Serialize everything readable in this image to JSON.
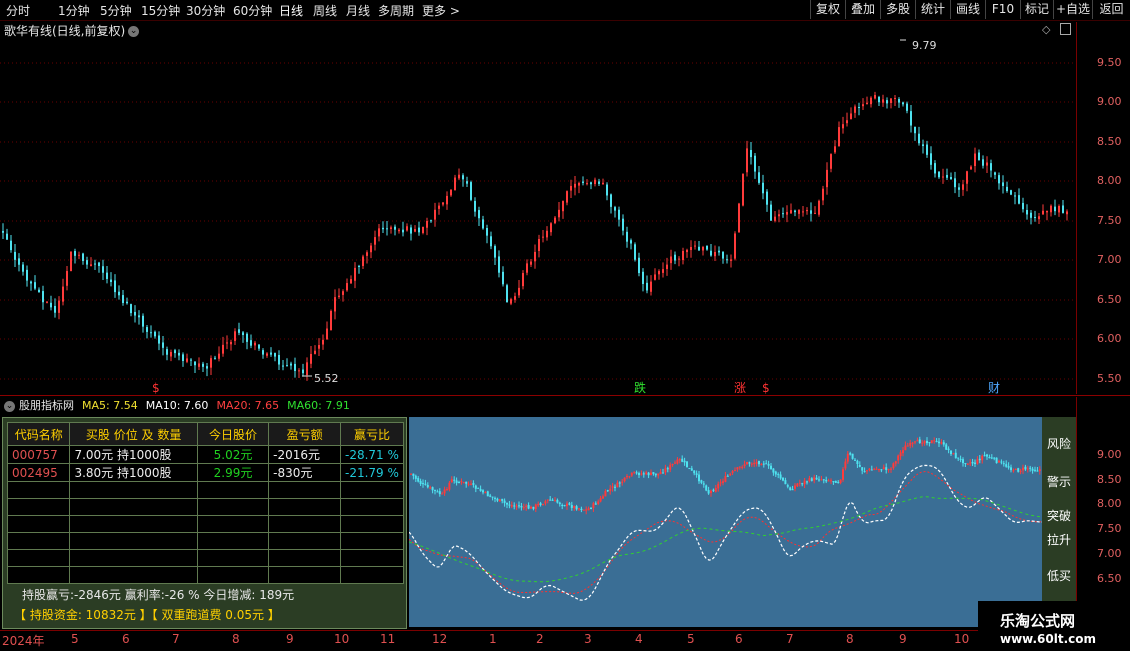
{
  "toolbar": {
    "periods": [
      "分时",
      "1分钟",
      "5分钟",
      "15分钟",
      "30分钟",
      "60分钟",
      "日线",
      "周线",
      "月线",
      "多周期",
      "更多 >"
    ],
    "right_buttons": [
      "复权",
      "叠加",
      "多股",
      "统计",
      "画线",
      "F10",
      "标记",
      "+自选",
      "返回"
    ]
  },
  "stock_title": "歌华有线(日线,前复权)",
  "price_axis": [
    "9.50",
    "9.00",
    "8.50",
    "8.00",
    "7.50",
    "7.00",
    "6.50",
    "6.00",
    "5.50"
  ],
  "price_annotations": {
    "high": "9.79",
    "low": "5.52"
  },
  "event_markers": [
    "$",
    "跌",
    "涨",
    "$",
    "财"
  ],
  "indicator": {
    "name": "股朋指标网",
    "ma5": "MA5: 7.54",
    "ma10": "MA10: 7.60",
    "ma20": "MA20: 7.65",
    "ma60": "MA60: 7.91"
  },
  "portfolio": {
    "headers": [
      "代码名称",
      "买股 价位 及 数量",
      "今日股价",
      "盈亏额",
      "赢亏比"
    ],
    "rows": [
      {
        "code": "000757",
        "buy": "7.00元  持1000股",
        "price": "5.02元",
        "pl": "-2016元",
        "ratio": "-28.71 %"
      },
      {
        "code": "002495",
        "buy": "3.80元  持1000股",
        "price": "2.99元",
        "pl": "-830元",
        "ratio": "-21.79 %"
      }
    ],
    "summary1": "持股赢亏:-2846元      赢利率:-26 %      今日增减: 189元",
    "summary2": "【  持股资金: 10832元   】【  双重跑道费  0.05元   】"
  },
  "side_buttons": [
    "风险",
    "警示",
    "突破",
    "拉升",
    "低买"
  ],
  "lower_axis": [
    "9.00",
    "8.50",
    "8.00",
    "7.50",
    "7.00",
    "6.50"
  ],
  "date_axis": [
    "2024年",
    "5",
    "6",
    "7",
    "8",
    "9",
    "10",
    "11",
    "12",
    "1",
    "2",
    "3",
    "4",
    "5",
    "6",
    "7",
    "8",
    "9",
    "10"
  ],
  "watermark": {
    "title": "乐淘公式网",
    "url": "www.60lt.com"
  },
  "colors": {
    "up": "#ff3b3b",
    "down": "#4fe3f0",
    "grid": "#8b0000",
    "panel": "#2b3d24",
    "lower_bg": "#3a6e95"
  }
}
